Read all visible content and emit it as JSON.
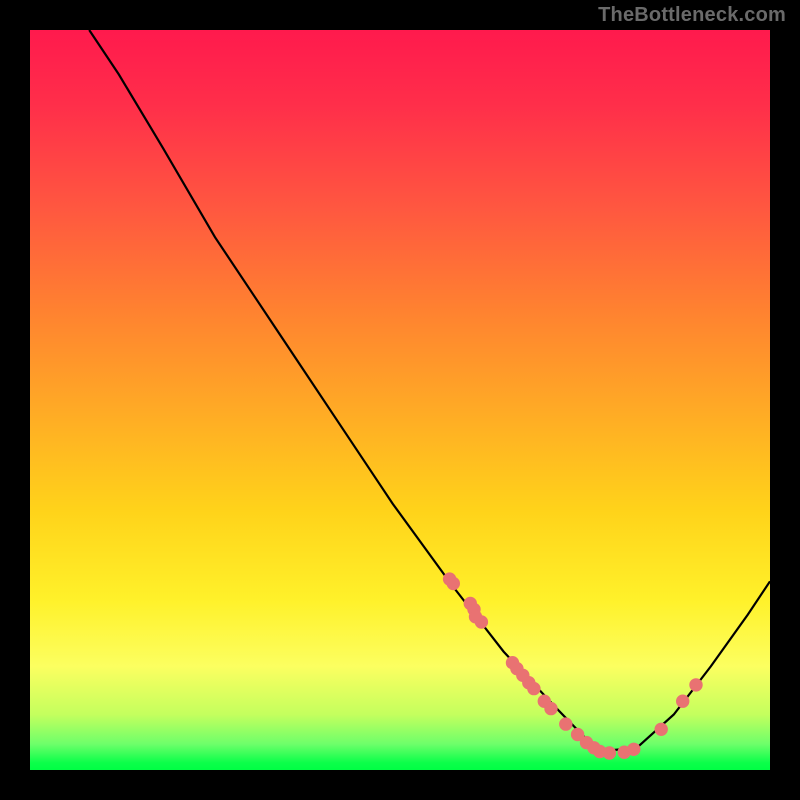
{
  "watermark": "TheBottleneck.com",
  "colors": {
    "background": "#000000",
    "curve": "#000000",
    "dot": "#e97272"
  },
  "chart_data": {
    "type": "line",
    "title": "",
    "xlabel": "",
    "ylabel": "",
    "xlim": [
      0,
      1
    ],
    "ylim": [
      0,
      1
    ],
    "series": [
      {
        "name": "curve",
        "x": [
          0.08,
          0.12,
          0.18,
          0.25,
          0.33,
          0.41,
          0.49,
          0.57,
          0.64,
          0.71,
          0.768,
          0.82,
          0.87,
          0.92,
          0.97,
          1.0
        ],
        "y": [
          1.0,
          0.94,
          0.84,
          0.72,
          0.6,
          0.48,
          0.36,
          0.25,
          0.16,
          0.085,
          0.025,
          0.03,
          0.075,
          0.14,
          0.21,
          0.255
        ]
      }
    ],
    "points": [
      {
        "x": 0.567,
        "y": 0.258
      },
      {
        "x": 0.572,
        "y": 0.252
      },
      {
        "x": 0.595,
        "y": 0.225
      },
      {
        "x": 0.6,
        "y": 0.217
      },
      {
        "x": 0.602,
        "y": 0.207
      },
      {
        "x": 0.61,
        "y": 0.2
      },
      {
        "x": 0.652,
        "y": 0.145
      },
      {
        "x": 0.658,
        "y": 0.137
      },
      {
        "x": 0.666,
        "y": 0.128
      },
      {
        "x": 0.674,
        "y": 0.118
      },
      {
        "x": 0.681,
        "y": 0.11
      },
      {
        "x": 0.695,
        "y": 0.093
      },
      {
        "x": 0.704,
        "y": 0.083
      },
      {
        "x": 0.724,
        "y": 0.062
      },
      {
        "x": 0.74,
        "y": 0.048
      },
      {
        "x": 0.752,
        "y": 0.037
      },
      {
        "x": 0.762,
        "y": 0.03
      },
      {
        "x": 0.77,
        "y": 0.025
      },
      {
        "x": 0.783,
        "y": 0.023
      },
      {
        "x": 0.803,
        "y": 0.024
      },
      {
        "x": 0.816,
        "y": 0.028
      },
      {
        "x": 0.853,
        "y": 0.055
      },
      {
        "x": 0.882,
        "y": 0.093
      },
      {
        "x": 0.9,
        "y": 0.115
      }
    ]
  }
}
